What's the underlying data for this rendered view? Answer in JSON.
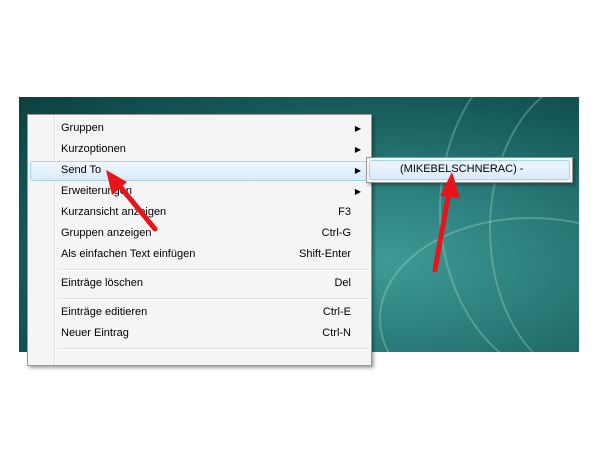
{
  "context_menu": {
    "items": [
      {
        "label": "Gruppen",
        "shortcut": "",
        "submenu": true
      },
      {
        "label": "Kurzoptionen",
        "shortcut": "",
        "submenu": true
      },
      {
        "label": "Send To",
        "shortcut": "",
        "submenu": true,
        "highlighted": true
      },
      {
        "label": "Erweiterungen",
        "shortcut": "",
        "submenu": true
      },
      {
        "label": "Kurzansicht anzeigen",
        "shortcut": "F3",
        "submenu": false
      },
      {
        "label": "Gruppen anzeigen",
        "shortcut": "Ctrl-G",
        "submenu": false
      },
      {
        "label": "Als einfachen Text einfügen",
        "shortcut": "Shift-Enter",
        "submenu": false
      },
      {
        "label": "Einträge löschen",
        "shortcut": "Del",
        "submenu": false
      },
      {
        "label": "Einträge editieren",
        "shortcut": "Ctrl-E",
        "submenu": false
      },
      {
        "label": "Neuer Eintrag",
        "shortcut": "Ctrl-N",
        "submenu": false
      }
    ],
    "submenu_arrow_glyph": "▶"
  },
  "submenu": {
    "item_label": "(MIKEBELSCHNERAC) -"
  },
  "colors": {
    "annotation_arrow": "#e8141a",
    "menu_highlight": "#d9ebfb",
    "desktop": "#1f6e6c"
  }
}
